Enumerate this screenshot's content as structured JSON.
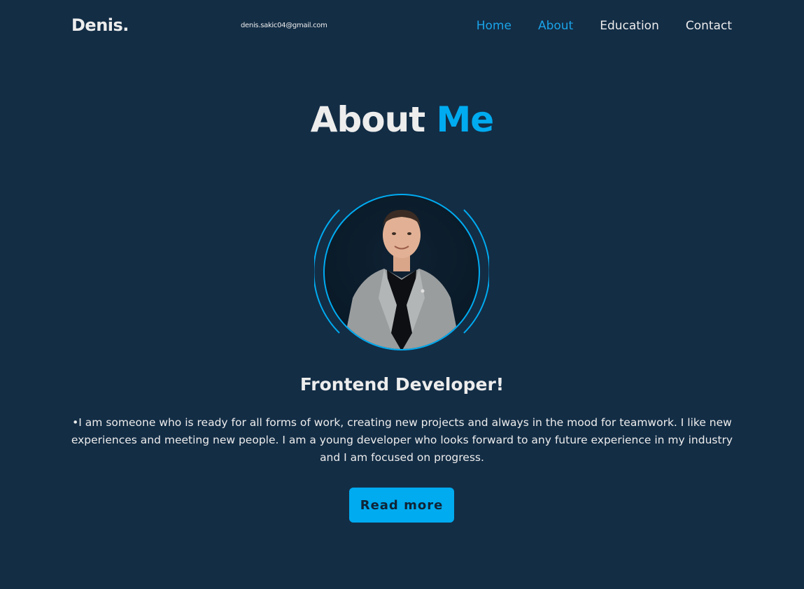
{
  "header": {
    "logo": "Denis.",
    "email": "denis.sakic04@gmail.com",
    "nav": [
      {
        "label": "Home",
        "active": true
      },
      {
        "label": "About",
        "active": true
      },
      {
        "label": "Education",
        "active": false
      },
      {
        "label": "Contact",
        "active": false
      }
    ]
  },
  "about": {
    "heading_main": "About",
    "heading_accent": "Me",
    "subtitle": "Frontend Developer!",
    "description": "•I am someone who is ready for all forms of work, creating new projects and always in the mood for teamwork. I like new experiences and meeting new people. I am a young developer who looks forward to any future experience in my industry and I am focused on progress.",
    "button_label": "Read more"
  },
  "colors": {
    "background": "#132d45",
    "accent": "#00abf0",
    "text": "#ededed"
  }
}
